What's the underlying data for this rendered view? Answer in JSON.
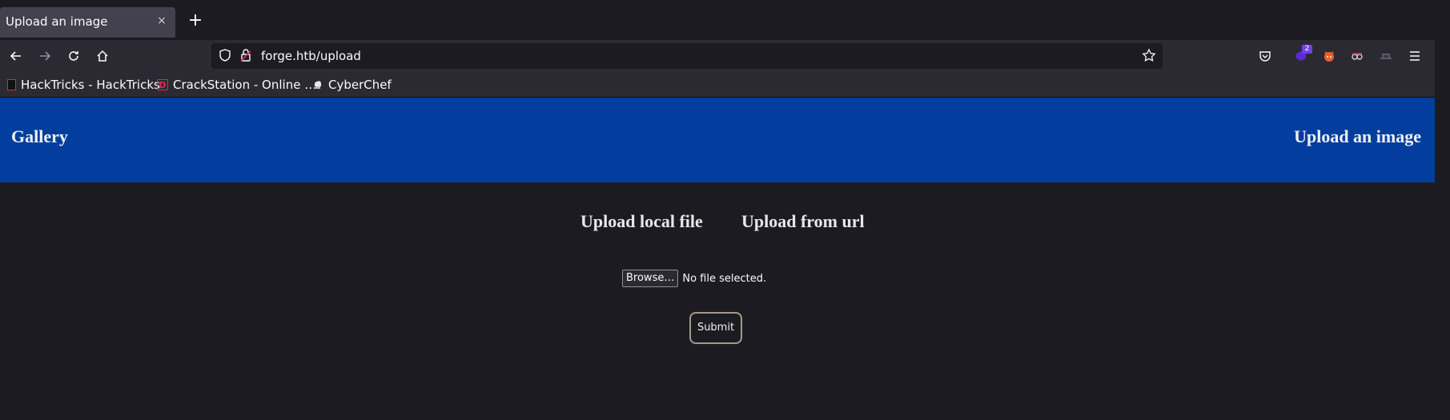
{
  "browser": {
    "tab": {
      "title": "Upload an image",
      "close_glyph": "×"
    },
    "new_tab_glyph": "+",
    "url": "forge.htb/upload",
    "extension_badge": "2",
    "bookmarks": [
      {
        "label": "HackTricks - HackTricks",
        "icon": "hacktricks-icon"
      },
      {
        "label": "CrackStation - Online …",
        "icon": "crackstation-icon",
        "icon_letter": "D"
      },
      {
        "label": "CyberChef",
        "icon": "cyberchef-icon"
      }
    ]
  },
  "site": {
    "brand": "Gallery",
    "nav_upload": "Upload an image",
    "header_color": "#033e9e",
    "modes": {
      "local": "Upload local file",
      "url": "Upload from url"
    },
    "file_input": {
      "button": "Browse…",
      "status": "No file selected."
    },
    "submit": "Submit"
  }
}
